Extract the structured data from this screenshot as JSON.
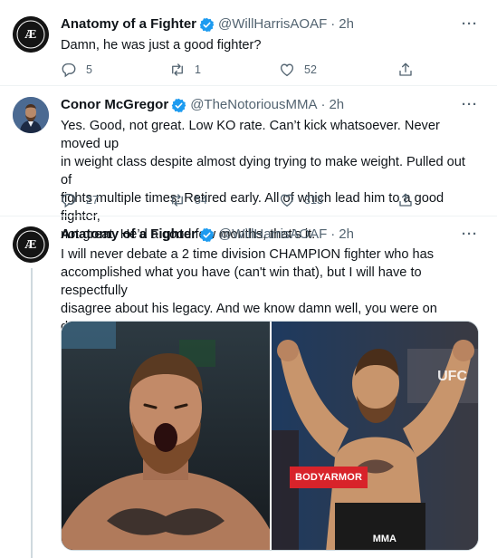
{
  "tweets": [
    {
      "author_name": "Anatomy of a Fighter",
      "handle": "@WillHarrisAOAF",
      "separator": "·",
      "time": "2h",
      "text": "Damn, he was just a good fighter?",
      "replies": "5",
      "retweets": "1",
      "likes": "52",
      "avatar_label": "ANATOMY OF A FIGHTER"
    },
    {
      "author_name": "Conor McGregor",
      "handle": "@TheNotoriousMMA",
      "separator": "·",
      "time": "2h",
      "text": "Yes. Good, not great. Low KO rate. Can’t kick whatsoever. Never moved up\nin weight class despite almost dying trying to make weight. Pulled out of\nfights multiple times. Retired early. All of which lead him to a good fighter,\nnot great. He’d a good few months, that’s it.",
      "replies": "27",
      "retweets": "54",
      "likes": "313"
    },
    {
      "author_name": "Anatomy of a Fighter",
      "handle": "@WillHarrisAOAF",
      "separator": "·",
      "time": "2h",
      "text": "I will never debate a 2 time division CHAMPION fighter who has\naccomplished what you have (can't win that), but I will have to respectfully\ndisagree about his legacy. And we know damn well, you were on deaths\ndoor with your featherweight reign beating all those little guys...",
      "avatar_label": "ANATOMY OF A FIGHTER"
    }
  ],
  "media": {
    "left_photo": "fighter-roaring-closeup",
    "right_photo": "fighter-flexing-weigh-in",
    "sponsor_text": "BODYARMOR",
    "event_text": "UFC",
    "watermark_text": "MMA"
  },
  "colors": {
    "text_primary": "#0f1419",
    "text_secondary": "#536471",
    "verified_blue": "#1d9bf0",
    "thread_line": "#cfd9de",
    "divider": "#eff3f4"
  },
  "icons": {
    "reply": "reply-icon",
    "retweet": "retweet-icon",
    "like": "heart-icon",
    "share": "share-icon",
    "more": "more-options-icon",
    "verified": "verified-badge-icon"
  }
}
